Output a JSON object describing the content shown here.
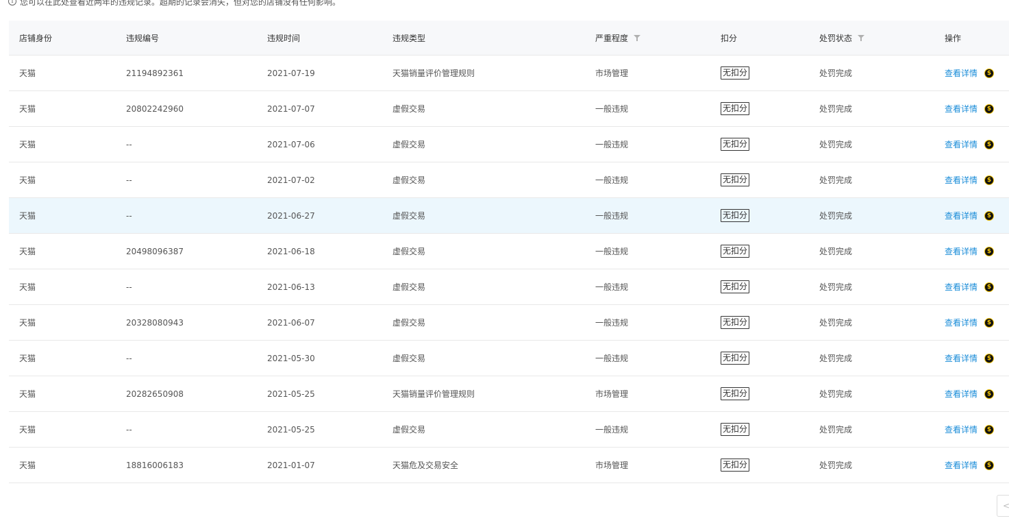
{
  "notice": {
    "icon": "info-icon",
    "text": "您可以在此处查看近两年的违规记录。超期的记录会消失，但对您的店铺没有任何影响。"
  },
  "table": {
    "columns": [
      {
        "label": "店铺身份",
        "filter": false
      },
      {
        "label": "违规编号",
        "filter": false
      },
      {
        "label": "违规时间",
        "filter": false
      },
      {
        "label": "违规类型",
        "filter": false
      },
      {
        "label": "严重程度",
        "filter": true
      },
      {
        "label": "扣分",
        "filter": false
      },
      {
        "label": "处罚状态",
        "filter": true
      },
      {
        "label": "操作",
        "filter": false
      }
    ],
    "action_label": "查看详情",
    "rows": [
      {
        "identity": "天猫",
        "id": "21194892361",
        "date": "2021-07-19",
        "type": "天猫销量评价管理规则",
        "severity": "市场管理",
        "points": "无扣分",
        "status": "处罚完成"
      },
      {
        "identity": "天猫",
        "id": "20802242960",
        "date": "2021-07-07",
        "type": "虚假交易",
        "severity": "一般违规",
        "points": "无扣分",
        "status": "处罚完成"
      },
      {
        "identity": "天猫",
        "id": "--",
        "date": "2021-07-06",
        "type": "虚假交易",
        "severity": "一般违规",
        "points": "无扣分",
        "status": "处罚完成"
      },
      {
        "identity": "天猫",
        "id": "--",
        "date": "2021-07-02",
        "type": "虚假交易",
        "severity": "一般违规",
        "points": "无扣分",
        "status": "处罚完成"
      },
      {
        "identity": "天猫",
        "id": "--",
        "date": "2021-06-27",
        "type": "虚假交易",
        "severity": "一般违规",
        "points": "无扣分",
        "status": "处罚完成",
        "highlight": true
      },
      {
        "identity": "天猫",
        "id": "20498096387",
        "date": "2021-06-18",
        "type": "虚假交易",
        "severity": "一般违规",
        "points": "无扣分",
        "status": "处罚完成"
      },
      {
        "identity": "天猫",
        "id": "--",
        "date": "2021-06-13",
        "type": "虚假交易",
        "severity": "一般违规",
        "points": "无扣分",
        "status": "处罚完成"
      },
      {
        "identity": "天猫",
        "id": "20328080943",
        "date": "2021-06-07",
        "type": "虚假交易",
        "severity": "一般违规",
        "points": "无扣分",
        "status": "处罚完成"
      },
      {
        "identity": "天猫",
        "id": "--",
        "date": "2021-05-30",
        "type": "虚假交易",
        "severity": "一般违规",
        "points": "无扣分",
        "status": "处罚完成"
      },
      {
        "identity": "天猫",
        "id": "20282650908",
        "date": "2021-05-25",
        "type": "天猫销量评价管理规则",
        "severity": "市场管理",
        "points": "无扣分",
        "status": "处罚完成"
      },
      {
        "identity": "天猫",
        "id": "--",
        "date": "2021-05-25",
        "type": "虚假交易",
        "severity": "一般违规",
        "points": "无扣分",
        "status": "处罚完成"
      },
      {
        "identity": "天猫",
        "id": "18816006183",
        "date": "2021-01-07",
        "type": "天猫危及交易安全",
        "severity": "市场管理",
        "points": "无扣分",
        "status": "处罚完成"
      }
    ]
  },
  "pager": {
    "prev_icon": "chevron-left-icon"
  }
}
